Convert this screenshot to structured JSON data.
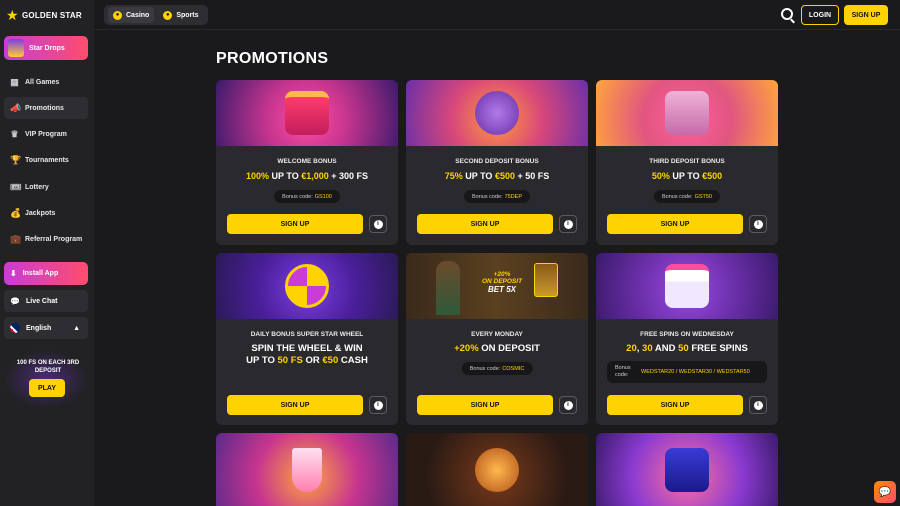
{
  "brand": {
    "name": "GOLDEN STAR",
    "accent": "#ffd300"
  },
  "sidebar": {
    "star_drops": "Star Drops",
    "items": [
      {
        "label": "All Games",
        "icon": "grid-icon"
      },
      {
        "label": "Promotions",
        "icon": "megaphone-icon"
      },
      {
        "label": "VIP Program",
        "icon": "crown-icon"
      },
      {
        "label": "Tournaments",
        "icon": "trophy-icon"
      },
      {
        "label": "Lottery",
        "icon": "ticket-icon"
      },
      {
        "label": "Jackpots",
        "icon": "money-bag-icon"
      },
      {
        "label": "Referral Program",
        "icon": "briefcase-icon"
      }
    ],
    "install_app": "Install App",
    "live_chat": "Live Chat",
    "language": "English",
    "promo_text": "100 FS ON EACH 3RD DEPOSIT",
    "promo_button": "PLAY"
  },
  "topbar": {
    "tabs": [
      {
        "label": "Casino"
      },
      {
        "label": "Sports"
      }
    ],
    "login": "LOGIN",
    "signup": "SIGN UP"
  },
  "page_title": "PROMOTIONS",
  "cards": [
    {
      "name": "WELCOME BONUS",
      "h1y": "100%",
      "h1": " UP TO ",
      "h2y": "€1,000",
      "h2": " + 300 FS",
      "code_label": "Bonus code:",
      "code": "GS100",
      "button": "SIGN UP"
    },
    {
      "name": "SECOND DEPOSIT BONUS",
      "h1y": "75%",
      "h1": " UP TO ",
      "h2y": "€500",
      "h2": " + 50 FS",
      "code_label": "Bonus code:",
      "code": "75DEP",
      "button": "SIGN UP"
    },
    {
      "name": "THIRD DEPOSIT BONUS",
      "h1y": "50%",
      "h1": " UP TO ",
      "h2y": "€500",
      "h2": "",
      "code_label": "Bonus code:",
      "code": "GST50",
      "button": "SIGN UP"
    },
    {
      "name": "DAILY BONUS SUPER STAR WHEEL",
      "line1": "SPIN THE WHEEL & WIN",
      "l2a": "UP TO ",
      "l2b": "50 FS",
      "l2c": " OR ",
      "l2d": "€50",
      "l2e": " CASH",
      "button": "SIGN UP"
    },
    {
      "name": "EVERY MONDAY",
      "h1y": "+20%",
      "h1": " ON DEPOSIT",
      "code_label": "Bonus code:",
      "code": "COSMIC",
      "button": "SIGN UP",
      "img_text1": "+20%",
      "img_text2": "ON DEPOSIT",
      "img_text3": "BET 5X"
    },
    {
      "name": "FREE SPINS ON WEDNESDAY",
      "la": "20",
      "lb": ", ",
      "lc": "30",
      "ld": " AND ",
      "le": "50",
      "lf": " FREE SPINS",
      "code_label": "Bonus code:",
      "code": "WEDSTAR20 / WEDSTAR30 / WEDSTAR50",
      "button": "SIGN UP"
    }
  ]
}
